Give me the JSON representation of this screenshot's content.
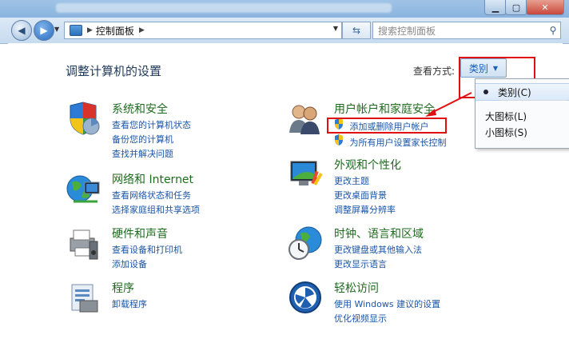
{
  "address": {
    "path": "控制面板",
    "search_placeholder": "搜索控制面板"
  },
  "main": {
    "heading": "调整计算机的设置",
    "view_by_label": "查看方式:",
    "view_by_value": "类别"
  },
  "categories": [
    {
      "title": "系统和安全",
      "links": [
        "查看您的计算机状态",
        "备份您的计算机",
        "查找并解决问题"
      ],
      "icon": "shield-icon"
    },
    {
      "title": "网络和 Internet",
      "links": [
        "查看网络状态和任务",
        "选择家庭组和共享选项"
      ],
      "icon": "network-icon"
    },
    {
      "title": "硬件和声音",
      "links": [
        "查看设备和打印机",
        "添加设备"
      ],
      "icon": "printer-icon"
    },
    {
      "title": "程序",
      "links": [
        "卸载程序"
      ],
      "icon": "programs-icon"
    },
    {
      "title": "用户帐户和家庭安全",
      "links": [
        "添加或删除用户帐户",
        "为所有用户设置家长控制"
      ],
      "icon": "users-icon"
    },
    {
      "title": "外观和个性化",
      "links": [
        "更改主题",
        "更改桌面背景",
        "调整屏幕分辨率"
      ],
      "icon": "monitor-icon"
    },
    {
      "title": "时钟、语言和区域",
      "links": [
        "更改键盘或其他输入法",
        "更改显示语言"
      ],
      "icon": "clock-globe-icon"
    },
    {
      "title": "轻松访问",
      "links": [
        "使用 Windows 建议的设置",
        "优化视频显示"
      ],
      "icon": "ease-of-access-icon"
    }
  ],
  "view_menu": {
    "items": [
      "类别(C)",
      "大图标(L)",
      "小图标(S)"
    ],
    "selected_index": 0
  },
  "colors": {
    "highlight": "#e01010",
    "link": "#1a55a8",
    "category_title": "#1e6b1e"
  }
}
